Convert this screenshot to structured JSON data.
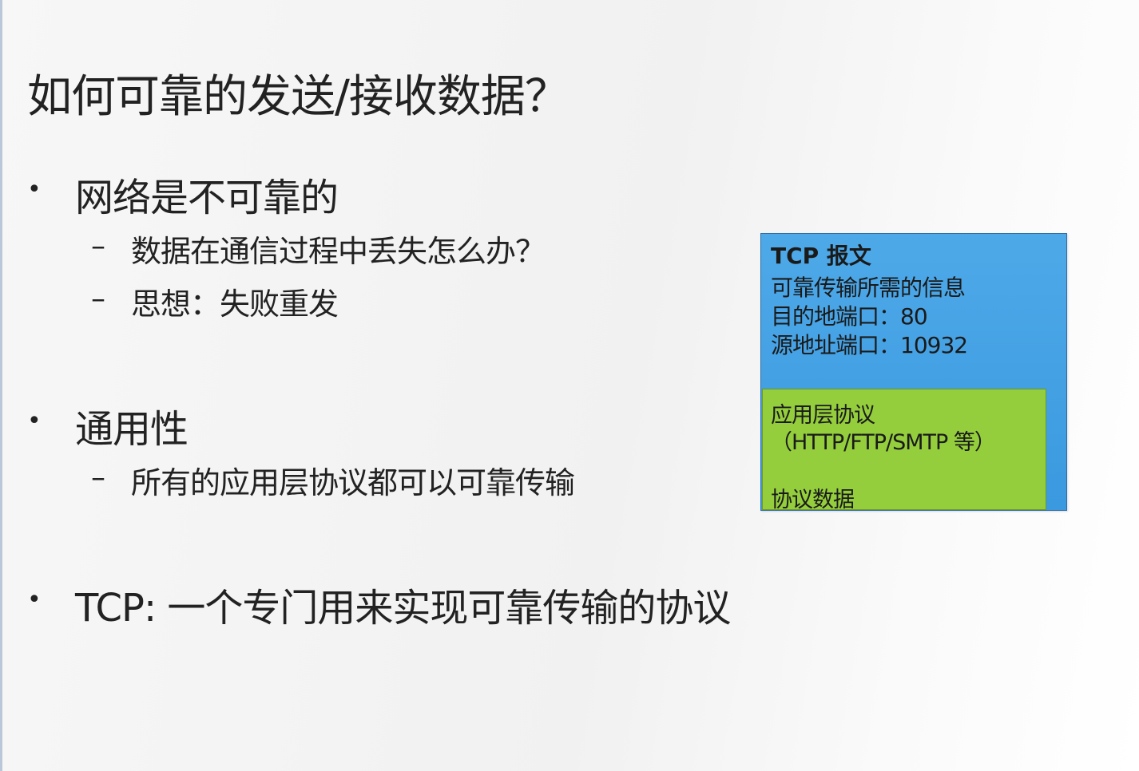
{
  "slide": {
    "title": "如何可靠的发送/接收数据？",
    "bullets": [
      {
        "text": "网络是不可靠的",
        "sub": [
          "数据在通信过程中丢失怎么办？",
          "思想：失败重发"
        ]
      },
      {
        "text": "通用性",
        "sub": [
          "所有的应用层协议都可以可靠传输"
        ]
      },
      {
        "text": "TCP: 一个专门用来实现可靠传输的协议",
        "sub": []
      }
    ],
    "bullet_symbol": "•",
    "sub_bullet_symbol": "–"
  },
  "diagram": {
    "tcp_box": {
      "title": "TCP 报文",
      "lines": [
        "可靠传输所需的信息",
        "目的地端口：80",
        "源地址端口：10932"
      ],
      "color": "#42a2e4"
    },
    "app_box": {
      "lines": [
        "应用层协议",
        "（HTTP/FTP/SMTP 等）",
        "协议数据"
      ],
      "color": "#94ce3c"
    }
  }
}
